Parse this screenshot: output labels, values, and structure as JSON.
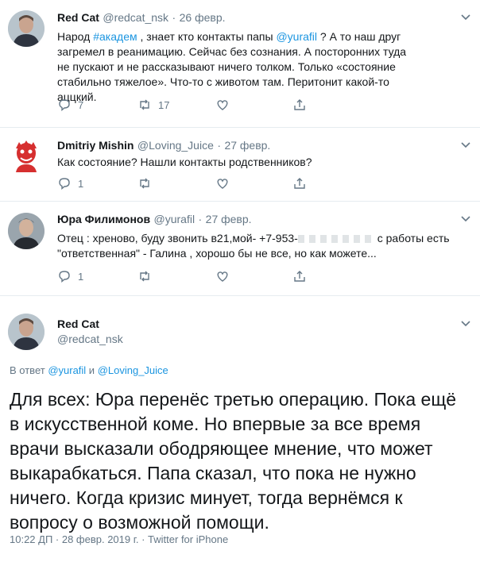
{
  "tweets": [
    {
      "name": "Red Cat",
      "handle": "@redcat_nsk",
      "date": "26 февр.",
      "text_parts": {
        "p1": "Народ ",
        "hashtag": "#академ",
        "p2": " , знает кто контакты папы ",
        "mention": "@yurafil",
        "p3": " ? А то наш друг загремел в реанимацию. Сейчас без сознания. А посторонних туда не пускают и не рассказывают ничего толком. Только «состояние стабильно тяжелое». Что-то с животом там. Перитонит какой-то аццкий."
      },
      "replies": "7",
      "retweets": "17",
      "likes": ""
    },
    {
      "name": "Dmitriy Mishin",
      "handle": "@Loving_Juice",
      "date": "27 февр.",
      "text": "Как состояние? Нашли контакты родственников?",
      "replies": "1",
      "retweets": "",
      "likes": ""
    },
    {
      "name": "Юра Филимонов",
      "handle": "@yurafil",
      "date": "27 февр.",
      "text_line1": "Отец : хреново, буду звонить в21,мой- +7-953-",
      "text_line1_end": " с работы есть",
      "text_line2": "\"ответственная\" - Галина , хорошо бы не все, но как можете...",
      "replies": "1",
      "retweets": "",
      "likes": ""
    }
  ],
  "main": {
    "name": "Red Cat",
    "handle": "@redcat_nsk",
    "reply_prefix": "В ответ ",
    "reply_user1": "@yurafil",
    "reply_and": " и ",
    "reply_user2": "@Loving_Juice",
    "text": "Для всех: Юра перенёс третью операцию. Пока ещё в искусственной коме. Но впервые за все время врачи высказали ободряющее мнение, что может выкарабкаться. Папа сказал, что пока не нужно ничего. Когда кризис минует, тогда вернёмся к вопросу о возможной помощи.",
    "meta": "10:22 ДП · 28 февр. 2019 г. · Twitter for iPhone"
  },
  "colors": {
    "link": "#1b95e0",
    "secondary": "#657786",
    "text": "#14171a",
    "divider": "#e6ecf0"
  }
}
